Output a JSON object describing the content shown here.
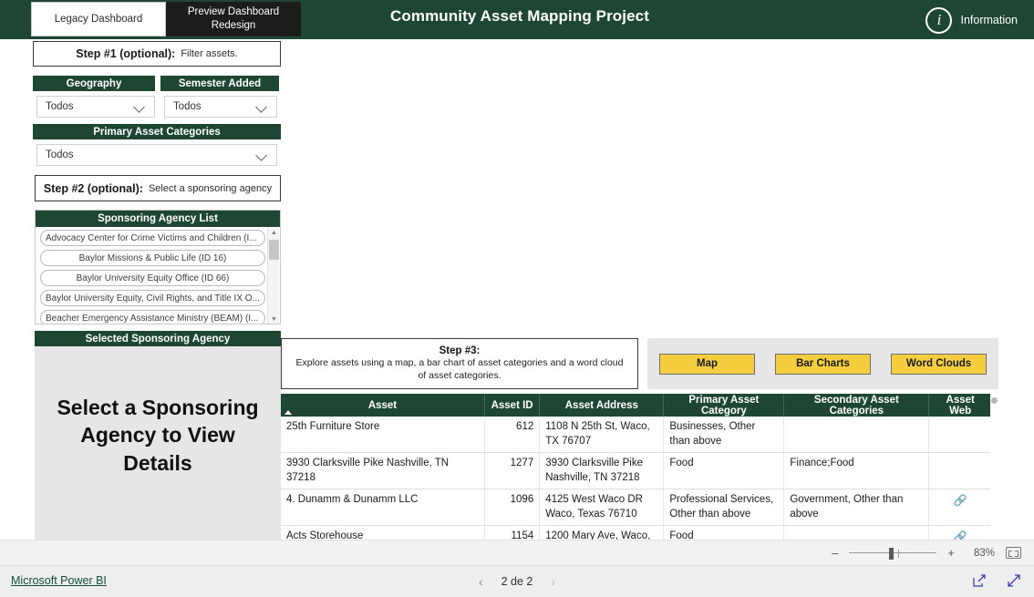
{
  "header": {
    "title": "Community Asset Mapping Project",
    "information_label": "Information",
    "information_icon": "info-circle-icon",
    "tabs": [
      {
        "label": "Legacy Dashboard",
        "active": false
      },
      {
        "label": "Preview Dashboard Redesign",
        "active": true
      }
    ]
  },
  "steps": {
    "step1_strong": "Step #1 (optional):",
    "step1_text": "Filter assets.",
    "step2_strong": "Step #2 (optional):",
    "step2_text": "Select a sponsoring agency",
    "step3_title": "Step #3:",
    "step3_desc": "Explore assets using a map, a bar chart of asset categories and a word cloud of asset categories."
  },
  "filters": {
    "geography": {
      "label": "Geography",
      "value": "Todos"
    },
    "semester_added": {
      "label": "Semester Added",
      "value": "Todos"
    },
    "primary_asset_categories": {
      "label": "Primary Asset Categories",
      "value": "Todos"
    }
  },
  "agency_list": {
    "title": "Sponsoring Agency List",
    "items": [
      "Advocacy Center for Crime Victims and Children (I...",
      "Baylor Missions & Public Life (ID 16)",
      "Baylor University Equity Office (ID 66)",
      "Baylor University Equity, Civil Rights, and Title IX O...",
      "Beacher Emergency Assistance Ministry (BEAM) (I..."
    ]
  },
  "selected_agency": {
    "title": "Selected Sponsoring Agency",
    "message": "Select a Sponsoring Agency to View Details"
  },
  "view_buttons": [
    {
      "label": "Map"
    },
    {
      "label": "Bar Charts"
    },
    {
      "label": "Word Clouds"
    }
  ],
  "table": {
    "columns": [
      "Asset",
      "Asset ID",
      "Asset Address",
      "Primary Asset Category",
      "Secondary Asset Categories",
      "Asset Web"
    ],
    "sorted_column": "Asset",
    "sort_direction": "ascending",
    "rows": [
      {
        "asset": "25th Furniture Store",
        "asset_id": "612",
        "address": "1108 N 25th St, Waco, TX 76707",
        "primary_category": "Businesses, Other than above",
        "secondary_categories": "",
        "web": ""
      },
      {
        "asset": "3930 Clarksville Pike Nashville, TN 37218",
        "asset_id": "1277",
        "address": "3930 Clarksville Pike Nashville, TN 37218",
        "primary_category": "Food",
        "secondary_categories": "Finance;Food",
        "web": ""
      },
      {
        "asset": "4. Dunamm & Dunamm LLC",
        "asset_id": "1096",
        "address": "4125 West Waco DR Waco, Texas 76710",
        "primary_category": "Professional Services, Other than above",
        "secondary_categories": "Government, Other than above",
        "web": "link-icon"
      },
      {
        "asset": "Acts Storehouse",
        "asset_id": "1154",
        "address": "1200 Mary Ave, Waco,",
        "primary_category": "Food",
        "secondary_categories": "",
        "web": "link-icon"
      }
    ]
  },
  "statusbar": {
    "zoom_minus": "–",
    "zoom_plus": "+",
    "zoom_percent": "83%",
    "fit_icon": "fit-to-page-icon"
  },
  "footer": {
    "brand": "Microsoft Power BI",
    "page_label": "2 de 2",
    "prev_icon": "chevron-left-icon",
    "next_icon": "chevron-right-icon",
    "share_icon": "share-icon",
    "fullscreen_icon": "fullscreen-icon"
  },
  "colors": {
    "brand_green": "#1d4733",
    "accent_yellow": "#f5ce40",
    "panel_gray": "#e6e6e6"
  }
}
